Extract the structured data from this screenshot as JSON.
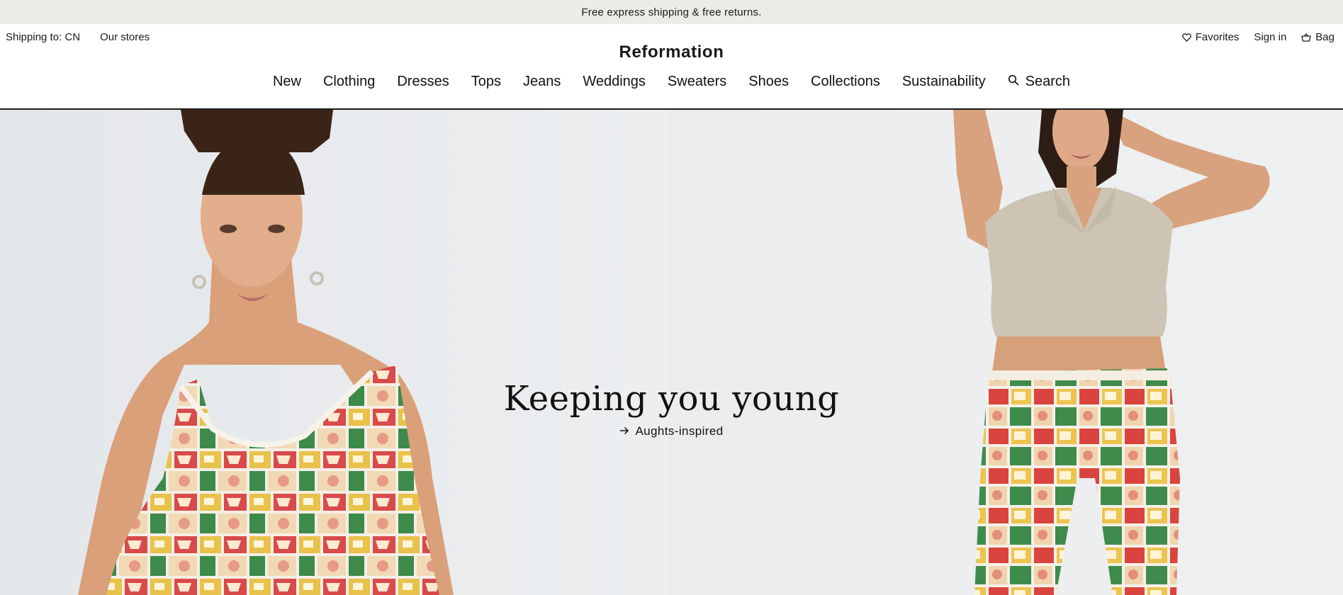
{
  "promo": {
    "text": "Free express shipping & free returns."
  },
  "header": {
    "shipping_label": "Shipping to: CN",
    "stores_label": "Our stores",
    "favorites_label": "Favorites",
    "signin_label": "Sign in",
    "bag_label": "Bag",
    "logo": "Reformation"
  },
  "nav": {
    "items": [
      {
        "label": "New"
      },
      {
        "label": "Clothing"
      },
      {
        "label": "Dresses"
      },
      {
        "label": "Tops"
      },
      {
        "label": "Jeans"
      },
      {
        "label": "Weddings"
      },
      {
        "label": "Sweaters"
      },
      {
        "label": "Shoes"
      },
      {
        "label": "Collections"
      },
      {
        "label": "Sustainability"
      }
    ],
    "search_label": "Search"
  },
  "hero": {
    "title": "Keeping you young",
    "link_label": "Aughts-inspired",
    "link_icon": "arrow-right-icon"
  },
  "colors": {
    "promo_bg": "#ecebe5",
    "text": "#1a1a1a",
    "hero_bg": "#e8eaec"
  }
}
